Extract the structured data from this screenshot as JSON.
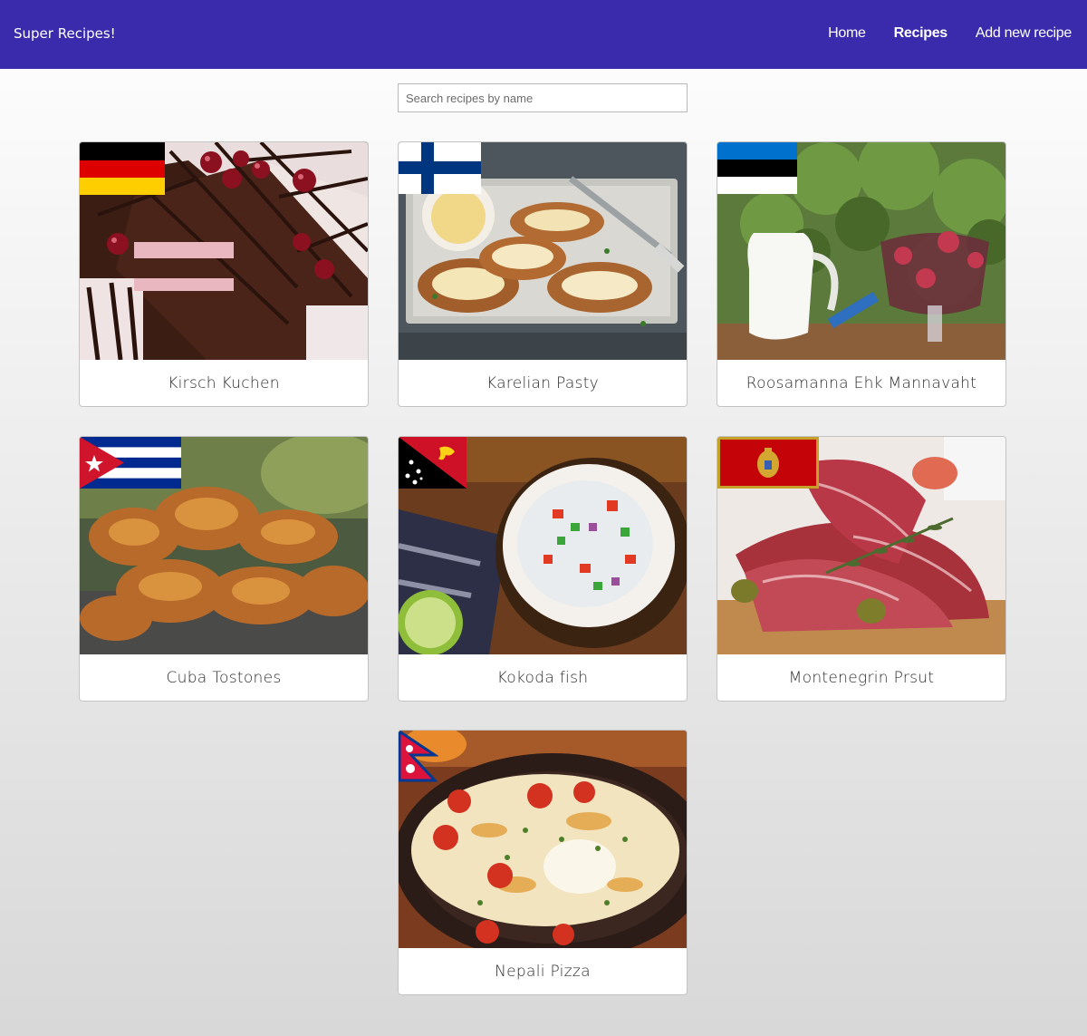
{
  "navbar": {
    "brand": "Super Recipes!",
    "links": [
      {
        "label": "Home",
        "active": false
      },
      {
        "label": "Recipes",
        "active": true
      },
      {
        "label": "Add new recipe",
        "active": false
      }
    ],
    "background": "#3a2bad"
  },
  "search": {
    "placeholder": "Search recipes by name",
    "value": ""
  },
  "recipes": [
    {
      "name": "Kirsch Kuchen",
      "country_flag": "germany-flag"
    },
    {
      "name": "Karelian Pasty",
      "country_flag": "finland-flag"
    },
    {
      "name": "Roosamanna Ehk Mannavaht",
      "country_flag": "estonia-flag"
    },
    {
      "name": "Cuba Tostones",
      "country_flag": "cuba-flag"
    },
    {
      "name": "Kokoda fish",
      "country_flag": "papua-new-guinea-flag"
    },
    {
      "name": "Montenegrin Prsut",
      "country_flag": "montenegro-flag"
    },
    {
      "name": "Nepali Pizza",
      "country_flag": "nepal-flag"
    }
  ]
}
